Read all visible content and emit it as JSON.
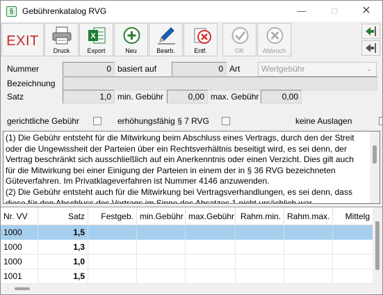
{
  "window": {
    "title": "Gebührenkatalog RVG",
    "app_icon_glyph": "§"
  },
  "toolbar": {
    "exit_label": "EXIT",
    "buttons": [
      {
        "label": "Druck",
        "icon": "printer-icon"
      },
      {
        "label": "Export",
        "icon": "excel-icon"
      },
      {
        "label": "Neu",
        "icon": "plus-icon"
      },
      {
        "label": "Bearb.",
        "icon": "pencil-icon"
      },
      {
        "label": "Entf.",
        "icon": "delete-icon"
      },
      {
        "label": "OK",
        "icon": "check-icon",
        "disabled": true
      },
      {
        "label": "Abbruch",
        "icon": "cancel-icon",
        "disabled": true
      }
    ],
    "side_buttons": [
      {
        "icon": "arrow-left-green-icon"
      },
      {
        "icon": "arrow-left-gray-icon"
      }
    ]
  },
  "form": {
    "nummer_label": "Nummer",
    "nummer_value": "0",
    "basiert_label": "basiert auf",
    "basiert_value": "0",
    "art_label": "Art",
    "art_value": "Wertgebühr",
    "bezeichnung_label": "Bezeichnung",
    "bezeichnung_value": "",
    "satz_label": "Satz",
    "satz_value": "1,0",
    "min_label": "min. Gebühr",
    "min_value": "0,00",
    "max_label": "max. Gebühr",
    "max_value": "0,00",
    "chk_gerichtlich": "gerichtliche Gebühr",
    "chk_erhoehung": "erhöhungsfähig § 7 RVG",
    "chk_auslagen": "keine Auslagen"
  },
  "memo": {
    "text": "(1) Die Gebühr entsteht für die Mitwirkung beim Abschluss eines Vertrags, durch den der Streit\noder die Ungewissheit der Parteien über ein Rechtsverhältnis beseitigt wird, es sei denn, der\nVertrag beschränkt sich ausschließlich auf ein Anerkenntnis oder einen Verzicht. Dies gilt auch\nfür die Mitwirkung bei einer Einigung der Parteien in einem der in § 36 RVG bezeichneten\nGüteverfahren. Im Privatklageverfahren ist Nummer 4146 anzuwenden.\n(2) Die Gebühr entsteht auch für die Mitwirkung bei Vertragsverhandlungen, es sei denn, dass\ndiese für den Abschluss des Vertrags im Sinne des Absatzes 1 nicht ursächlich war."
  },
  "grid": {
    "columns": [
      "Nr. VV",
      "Satz",
      "Festgeb.",
      "min.Gebühr",
      "max.Gebühr",
      "Rahm.min.",
      "Rahm.max.",
      "Mittelg"
    ],
    "rows": [
      {
        "nr": "1000",
        "satz": "1,5",
        "selected": true
      },
      {
        "nr": "1000",
        "satz": "1,3",
        "selected": false
      },
      {
        "nr": "1000",
        "satz": "1,0",
        "selected": false
      },
      {
        "nr": "1001",
        "satz": "1,5",
        "selected": false
      }
    ]
  },
  "colors": {
    "selection": "#a6cfee",
    "exit_red": "#c62828",
    "excel_green": "#1e7e34"
  }
}
